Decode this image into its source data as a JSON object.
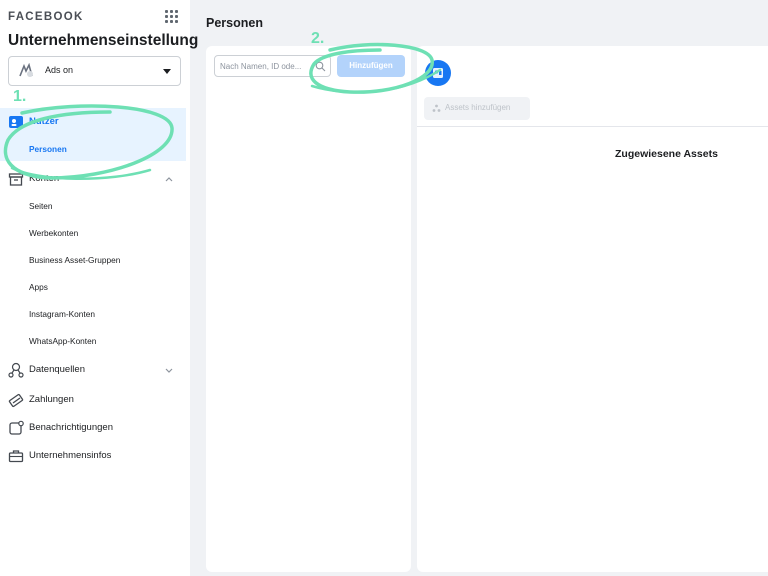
{
  "app": {
    "brand": "FACEBOOK"
  },
  "sidebar": {
    "title": "Unternehmenseinstellung",
    "account": {
      "label": "Ads on"
    },
    "nutzer": {
      "label": "Nutzer",
      "items": [
        {
          "label": "Personen"
        }
      ]
    },
    "konten": {
      "label": "Konten",
      "items": [
        {
          "label": "Seiten"
        },
        {
          "label": "Werbekonten"
        },
        {
          "label": "Business Asset-Gruppen"
        },
        {
          "label": "Apps"
        },
        {
          "label": "Instagram-Konten"
        },
        {
          "label": "WhatsApp-Konten"
        }
      ]
    },
    "datenquellen": {
      "label": "Datenquellen"
    },
    "zahlungen": {
      "label": "Zahlungen"
    },
    "benachrichtigungen": {
      "label": "Benachrichtigungen"
    },
    "unternehmensinfos": {
      "label": "Unternehmensinfos"
    }
  },
  "main": {
    "title": "Personen",
    "search": {
      "placeholder": "Nach Namen, ID ode..."
    },
    "add_button": "Hinzufügen",
    "assets_button": "Assets hinzufügen",
    "assigned_title": "Zugewiesene Assets"
  },
  "annotations": {
    "step1": "1.",
    "step2": "2.",
    "color": "#6ee0b4"
  }
}
